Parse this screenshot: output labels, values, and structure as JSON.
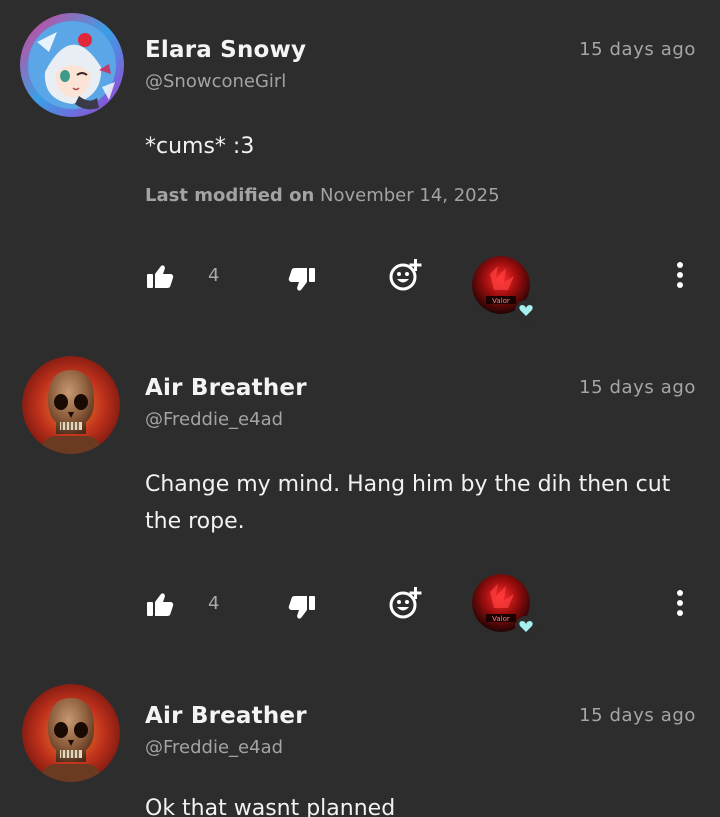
{
  "colors": {
    "background": "#2d2d2e",
    "text_primary": "#f2f2f2",
    "text_secondary": "#a3a3a3",
    "heart_badge": "#a7f0f0"
  },
  "comments": [
    {
      "author_name": "Elara Snowy",
      "handle": "@SnowconeGirl",
      "time": "15 days ago",
      "text": "*cums* :3",
      "modified_label": "Last modified on",
      "modified_date": "November 14, 2025",
      "like_count": "4",
      "avatar_icon": "anime-girl-avatar"
    },
    {
      "author_name": "Air Breather",
      "handle": "@Freddie_e4ad",
      "time": "15 days ago",
      "text": "Change my mind. Hang him by the dih then cut the rope.",
      "like_count": "4",
      "avatar_icon": "skull-avatar"
    },
    {
      "author_name": "Air Breather",
      "handle": "@Freddie_e4ad",
      "time": "15 days ago",
      "text": "Ok that wasnt planned",
      "avatar_icon": "skull-avatar"
    }
  ],
  "icons": {
    "like": "thumbs-up-icon",
    "dislike": "thumbs-down-icon",
    "react": "add-reaction-icon",
    "more": "more-vertical-icon",
    "reactor": "reactor-avatar",
    "heart": "heart-icon"
  }
}
